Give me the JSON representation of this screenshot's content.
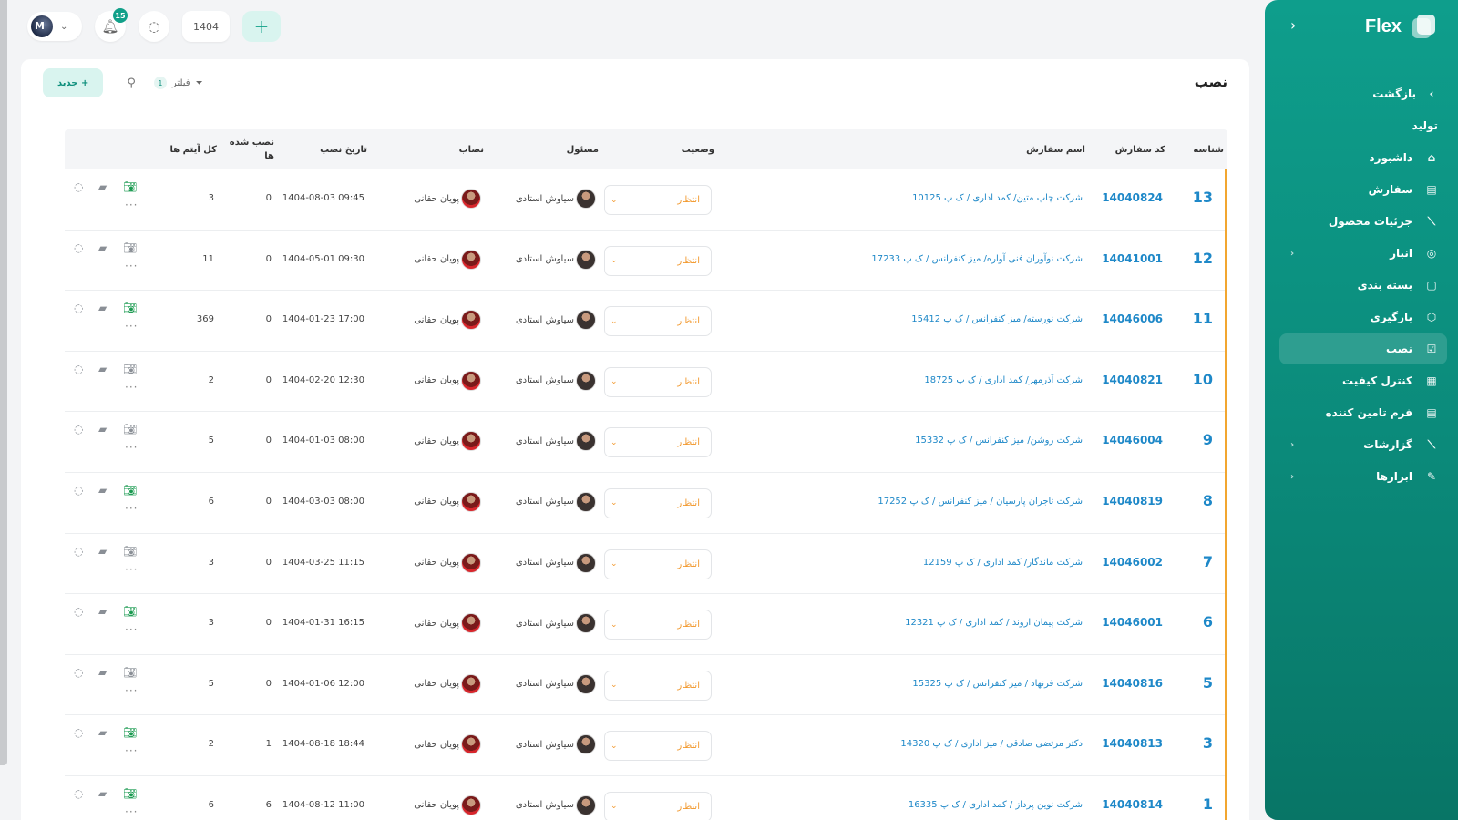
{
  "sidebar": {
    "brand": "Flex",
    "items": [
      {
        "label": "بازگشت",
        "icon": "chevron-right-icon",
        "glyph": "›",
        "kind": "back"
      },
      {
        "label": "تولید",
        "icon": "",
        "glyph": "",
        "kind": "section"
      },
      {
        "label": "داشبورد",
        "icon": "home-icon",
        "glyph": "⌂",
        "kind": "item"
      },
      {
        "label": "سفارش",
        "icon": "order-icon",
        "glyph": "▤",
        "kind": "item"
      },
      {
        "label": "جزئیات محصول",
        "icon": "chart-icon",
        "glyph": "⟋",
        "kind": "item"
      },
      {
        "label": "انبار",
        "icon": "warehouse-icon",
        "glyph": "◎",
        "kind": "item",
        "submenu": true
      },
      {
        "label": "بسته بندی",
        "icon": "package-icon",
        "glyph": "▢",
        "kind": "item"
      },
      {
        "label": "بارگیری",
        "icon": "box-icon",
        "glyph": "⬡",
        "kind": "item"
      },
      {
        "label": "نصب",
        "icon": "clipboard-check-icon",
        "glyph": "☑",
        "kind": "item",
        "active": true
      },
      {
        "label": "کنترل کیفیت",
        "icon": "checklist-icon",
        "glyph": "▦",
        "kind": "item"
      },
      {
        "label": "فرم تامین کننده",
        "icon": "form-icon",
        "glyph": "▤",
        "kind": "item"
      },
      {
        "label": "گزارشات",
        "icon": "report-icon",
        "glyph": "⟋",
        "kind": "item",
        "submenu": true
      },
      {
        "label": "ابزارها",
        "icon": "tool-icon",
        "glyph": "✎",
        "kind": "item",
        "submenu": true
      }
    ]
  },
  "topbar": {
    "notification_count": "15",
    "year": "1404",
    "add_symbol": "+"
  },
  "page": {
    "title": "نصب",
    "new_button": "+ جدید",
    "filter_label": "فیلتر",
    "filter_count": "1"
  },
  "table": {
    "headers": {
      "id": "شناسه",
      "code": "کد سفارش",
      "name": "اسم سفارش",
      "status": "وضعیت",
      "responsible": "مسئول",
      "installer": "نصاب",
      "date": "تاریخ نصب",
      "installed": "نصب شده ها",
      "total": "کل آیتم ها"
    },
    "rows": [
      {
        "id": "13",
        "code": "14040824",
        "name": "شرکت چاپ متین/ کمد اداری / ک پ 10125",
        "status": "انتظار",
        "responsible": "سیاوش استادی",
        "installer": "پویان حقانی",
        "date": "1404-08-03 09:45",
        "installed": "0",
        "total": "3",
        "camera": "green"
      },
      {
        "id": "12",
        "code": "14041001",
        "name": "شرکت نوآوران فنی آواره/ میز کنفرانس / ک پ 17233",
        "status": "انتظار",
        "responsible": "سیاوش استادی",
        "installer": "پویان حقانی",
        "date": "1404-05-01 09:30",
        "installed": "0",
        "total": "11",
        "camera": "gray"
      },
      {
        "id": "11",
        "code": "14046006",
        "name": "شرکت نورسته/ میز کنفرانس / ک پ 15412",
        "status": "انتظار",
        "responsible": "سیاوش استادی",
        "installer": "پویان حقانی",
        "date": "1404-01-23 17:00",
        "installed": "0",
        "total": "369",
        "camera": "green"
      },
      {
        "id": "10",
        "code": "14040821",
        "name": "شرکت آذرمهر/ کمد اداری / ک پ 18725",
        "status": "انتظار",
        "responsible": "سیاوش استادی",
        "installer": "پویان حقانی",
        "date": "1404-02-20 12:30",
        "installed": "0",
        "total": "2",
        "camera": "gray"
      },
      {
        "id": "9",
        "code": "14046004",
        "name": "شرکت روشن/ میز کنفرانس / ک پ 15332",
        "status": "انتظار",
        "responsible": "سیاوش استادی",
        "installer": "پویان حقانی",
        "date": "1404-01-03 08:00",
        "installed": "0",
        "total": "5",
        "camera": "gray"
      },
      {
        "id": "8",
        "code": "14040819",
        "name": "شرکت تاجران پارسیان / میز کنفرانس / ک پ 17252",
        "status": "انتظار",
        "responsible": "سیاوش استادی",
        "installer": "پویان حقانی",
        "date": "1404-03-03 08:00",
        "installed": "0",
        "total": "6",
        "camera": "green"
      },
      {
        "id": "7",
        "code": "14046002",
        "name": "شرکت ماندگار/ کمد اداری / ک پ 12159",
        "status": "انتظار",
        "responsible": "سیاوش استادی",
        "installer": "پویان حقانی",
        "date": "1404-03-25 11:15",
        "installed": "0",
        "total": "3",
        "camera": "gray"
      },
      {
        "id": "6",
        "code": "14046001",
        "name": "شرکت پیمان اروند / کمد اداری / ک پ 12321",
        "status": "انتظار",
        "responsible": "سیاوش استادی",
        "installer": "پویان حقانی",
        "date": "1404-01-31 16:15",
        "installed": "0",
        "total": "3",
        "camera": "green"
      },
      {
        "id": "5",
        "code": "14040816",
        "name": "شرکت فرنهاد / میز کنفرانس / ک پ 15325",
        "status": "انتظار",
        "responsible": "سیاوش استادی",
        "installer": "پویان حقانی",
        "date": "1404-01-06 12:00",
        "installed": "0",
        "total": "5",
        "camera": "gray"
      },
      {
        "id": "3",
        "code": "14040813",
        "name": "دکتر مرتضی صادقی / میز اداری / ک پ 14320",
        "status": "انتظار",
        "responsible": "سیاوش استادی",
        "installer": "پویان حقانی",
        "date": "1404-08-18 18:44",
        "installed": "1",
        "total": "2",
        "camera": "green"
      },
      {
        "id": "1",
        "code": "14040814",
        "name": "شرکت نوین پرداز / کمد اداری / ک پ 16335",
        "status": "انتظار",
        "responsible": "سیاوش استادی",
        "installer": "پویان حقانی",
        "date": "1404-08-12 11:00",
        "installed": "6",
        "total": "6",
        "camera": "green"
      }
    ]
  },
  "colors": {
    "accent": "#0e9e8c",
    "link": "#1e88c8",
    "status": "#f2992e",
    "row_marker": "#f2a630",
    "camera_on": "#1a9a50"
  }
}
